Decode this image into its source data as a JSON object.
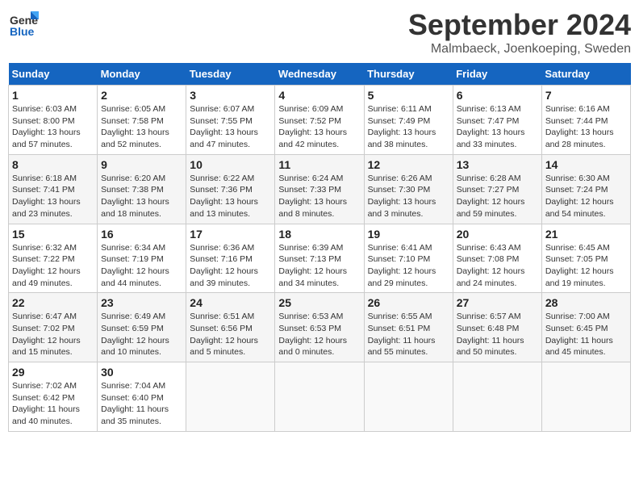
{
  "header": {
    "logo_general": "General",
    "logo_blue": "Blue",
    "month": "September 2024",
    "location": "Malmbaeck, Joenkoeping, Sweden"
  },
  "days_of_week": [
    "Sunday",
    "Monday",
    "Tuesday",
    "Wednesday",
    "Thursday",
    "Friday",
    "Saturday"
  ],
  "weeks": [
    [
      {
        "day": "1",
        "info": "Sunrise: 6:03 AM\nSunset: 8:00 PM\nDaylight: 13 hours\nand 57 minutes."
      },
      {
        "day": "2",
        "info": "Sunrise: 6:05 AM\nSunset: 7:58 PM\nDaylight: 13 hours\nand 52 minutes."
      },
      {
        "day": "3",
        "info": "Sunrise: 6:07 AM\nSunset: 7:55 PM\nDaylight: 13 hours\nand 47 minutes."
      },
      {
        "day": "4",
        "info": "Sunrise: 6:09 AM\nSunset: 7:52 PM\nDaylight: 13 hours\nand 42 minutes."
      },
      {
        "day": "5",
        "info": "Sunrise: 6:11 AM\nSunset: 7:49 PM\nDaylight: 13 hours\nand 38 minutes."
      },
      {
        "day": "6",
        "info": "Sunrise: 6:13 AM\nSunset: 7:47 PM\nDaylight: 13 hours\nand 33 minutes."
      },
      {
        "day": "7",
        "info": "Sunrise: 6:16 AM\nSunset: 7:44 PM\nDaylight: 13 hours\nand 28 minutes."
      }
    ],
    [
      {
        "day": "8",
        "info": "Sunrise: 6:18 AM\nSunset: 7:41 PM\nDaylight: 13 hours\nand 23 minutes."
      },
      {
        "day": "9",
        "info": "Sunrise: 6:20 AM\nSunset: 7:38 PM\nDaylight: 13 hours\nand 18 minutes."
      },
      {
        "day": "10",
        "info": "Sunrise: 6:22 AM\nSunset: 7:36 PM\nDaylight: 13 hours\nand 13 minutes."
      },
      {
        "day": "11",
        "info": "Sunrise: 6:24 AM\nSunset: 7:33 PM\nDaylight: 13 hours\nand 8 minutes."
      },
      {
        "day": "12",
        "info": "Sunrise: 6:26 AM\nSunset: 7:30 PM\nDaylight: 13 hours\nand 3 minutes."
      },
      {
        "day": "13",
        "info": "Sunrise: 6:28 AM\nSunset: 7:27 PM\nDaylight: 12 hours\nand 59 minutes."
      },
      {
        "day": "14",
        "info": "Sunrise: 6:30 AM\nSunset: 7:24 PM\nDaylight: 12 hours\nand 54 minutes."
      }
    ],
    [
      {
        "day": "15",
        "info": "Sunrise: 6:32 AM\nSunset: 7:22 PM\nDaylight: 12 hours\nand 49 minutes."
      },
      {
        "day": "16",
        "info": "Sunrise: 6:34 AM\nSunset: 7:19 PM\nDaylight: 12 hours\nand 44 minutes."
      },
      {
        "day": "17",
        "info": "Sunrise: 6:36 AM\nSunset: 7:16 PM\nDaylight: 12 hours\nand 39 minutes."
      },
      {
        "day": "18",
        "info": "Sunrise: 6:39 AM\nSunset: 7:13 PM\nDaylight: 12 hours\nand 34 minutes."
      },
      {
        "day": "19",
        "info": "Sunrise: 6:41 AM\nSunset: 7:10 PM\nDaylight: 12 hours\nand 29 minutes."
      },
      {
        "day": "20",
        "info": "Sunrise: 6:43 AM\nSunset: 7:08 PM\nDaylight: 12 hours\nand 24 minutes."
      },
      {
        "day": "21",
        "info": "Sunrise: 6:45 AM\nSunset: 7:05 PM\nDaylight: 12 hours\nand 19 minutes."
      }
    ],
    [
      {
        "day": "22",
        "info": "Sunrise: 6:47 AM\nSunset: 7:02 PM\nDaylight: 12 hours\nand 15 minutes."
      },
      {
        "day": "23",
        "info": "Sunrise: 6:49 AM\nSunset: 6:59 PM\nDaylight: 12 hours\nand 10 minutes."
      },
      {
        "day": "24",
        "info": "Sunrise: 6:51 AM\nSunset: 6:56 PM\nDaylight: 12 hours\nand 5 minutes."
      },
      {
        "day": "25",
        "info": "Sunrise: 6:53 AM\nSunset: 6:53 PM\nDaylight: 12 hours\nand 0 minutes."
      },
      {
        "day": "26",
        "info": "Sunrise: 6:55 AM\nSunset: 6:51 PM\nDaylight: 11 hours\nand 55 minutes."
      },
      {
        "day": "27",
        "info": "Sunrise: 6:57 AM\nSunset: 6:48 PM\nDaylight: 11 hours\nand 50 minutes."
      },
      {
        "day": "28",
        "info": "Sunrise: 7:00 AM\nSunset: 6:45 PM\nDaylight: 11 hours\nand 45 minutes."
      }
    ],
    [
      {
        "day": "29",
        "info": "Sunrise: 7:02 AM\nSunset: 6:42 PM\nDaylight: 11 hours\nand 40 minutes."
      },
      {
        "day": "30",
        "info": "Sunrise: 7:04 AM\nSunset: 6:40 PM\nDaylight: 11 hours\nand 35 minutes."
      },
      {
        "day": "",
        "info": ""
      },
      {
        "day": "",
        "info": ""
      },
      {
        "day": "",
        "info": ""
      },
      {
        "day": "",
        "info": ""
      },
      {
        "day": "",
        "info": ""
      }
    ]
  ]
}
